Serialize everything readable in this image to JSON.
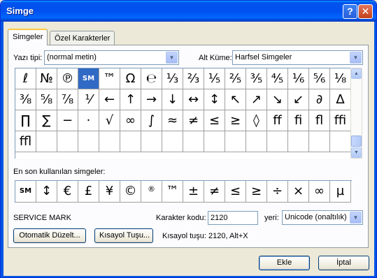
{
  "window": {
    "title": "Simge"
  },
  "titlebar": {
    "help_label": "?",
    "close_label": "✕"
  },
  "tabs": [
    {
      "label": "Simgeler"
    },
    {
      "label": "Özel Karakterler"
    }
  ],
  "font": {
    "label": "Yazı tipi:",
    "value": "(normal metin)"
  },
  "subset": {
    "label": "Alt Küme:",
    "value": "Harfsel Simgeler"
  },
  "symbol_grid": {
    "selected_index": 3,
    "cells": [
      "ℓ",
      "№",
      "℗",
      "SM",
      "™",
      "Ω",
      "℮",
      "⅓",
      "⅔",
      "⅕",
      "⅖",
      "⅗",
      "⅘",
      "⅙",
      "⅚",
      "⅛",
      "⅜",
      "⅝",
      "⅞",
      "⅟",
      "←",
      "↑",
      "→",
      "↓",
      "↔",
      "↕",
      "↖",
      "↗",
      "↘",
      "↙",
      "∂",
      "∆",
      "∏",
      "∑",
      "−",
      "·",
      "√",
      "∞",
      "∫",
      "≈",
      "≠",
      "≤",
      "≥",
      "◊",
      "ﬀ",
      "ﬁ",
      "ﬂ",
      "ﬃ",
      "ﬄ",
      "",
      "",
      "",
      "",
      "",
      "",
      "",
      "",
      "",
      "",
      "",
      "",
      "",
      "",
      ""
    ]
  },
  "recent": {
    "label": "En son kullanılan simgeler:",
    "cells": [
      "SM",
      "↕",
      "€",
      "£",
      "¥",
      "©",
      "®",
      "™",
      "±",
      "≠",
      "≤",
      "≥",
      "÷",
      "×",
      "∞",
      "µ"
    ]
  },
  "char_name": "SERVICE MARK",
  "char_code": {
    "label": "Karakter kodu:",
    "value": "2120"
  },
  "from": {
    "label": "yeri:",
    "value": "Unicode (onaltılık)"
  },
  "autocorrect_label": "Otomatik Düzelt...",
  "shortcut_key_label": "Kısayol Tuşu...",
  "shortcut_text": "Kısayol tuşu: 2120, Alt+X",
  "buttons": {
    "insert": "Ekle",
    "cancel": "İptal"
  },
  "icons": {
    "dropdown": "chevron-down-icon",
    "scroll_up": "arrow-up-icon",
    "scroll_down": "arrow-down-icon"
  }
}
